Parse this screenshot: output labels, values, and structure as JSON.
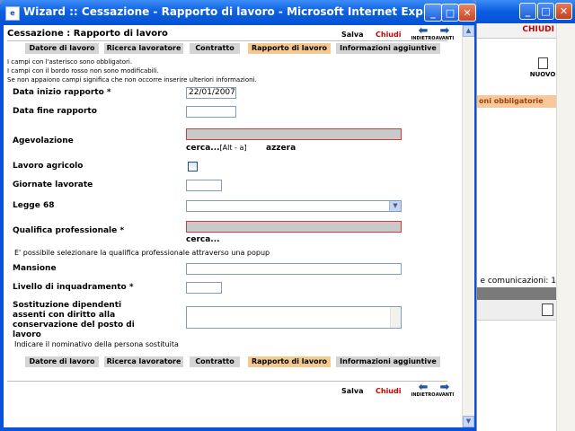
{
  "window": {
    "title": "Wizard :: Cessazione - Rapporto di lavoro - Microsoft Internet Explorer",
    "minimize_glyph": "_",
    "maximize_glyph": "□",
    "close_glyph": "✕"
  },
  "background_window": {
    "chiudi": "CHIUDI",
    "nuovo": "NUOVO",
    "obbligatorie": "oni obbligatorie",
    "comunicazioni": "e comunicazioni: 1"
  },
  "header": {
    "title": "Cessazione : Rapporto di lavoro"
  },
  "toolbar": {
    "salva": "Salva",
    "chiudi": "Chiudi",
    "indietro": "INDIETRO",
    "avanti": "AVANTI"
  },
  "tabs": [
    {
      "label": "Datore di lavoro"
    },
    {
      "label": "Ricerca lavoratore"
    },
    {
      "label": "Contratto"
    },
    {
      "label": "Rapporto di lavoro"
    },
    {
      "label": "Informazioni aggiuntive"
    }
  ],
  "notes": [
    "I campi con l'asterisco sono obbligatori.",
    "I campi con il bordo rosso non sono modificabili.",
    "Se non appaiono campi significa che non occorre inserire ulteriori informazioni."
  ],
  "form": {
    "data_inizio": {
      "label": "Data inizio rapporto *",
      "value": "22/01/2007"
    },
    "data_fine": {
      "label": "Data fine rapporto",
      "value": ""
    },
    "agevolazione": {
      "label": "Agevolazione",
      "value": "",
      "cerca": "cerca...",
      "shortcut": "[Alt - a]",
      "azzera": "azzera"
    },
    "lavoro_agricolo": {
      "label": "Lavoro agricolo"
    },
    "giornate": {
      "label": "Giornate lavorate",
      "value": ""
    },
    "legge68": {
      "label": "Legge 68",
      "value": ""
    },
    "qualifica": {
      "label": "Qualifica professionale *",
      "value": "",
      "cerca": "cerca..."
    },
    "qualifica_info": "E' possibile selezionare la qualifica professionale attraverso una popup",
    "mansione": {
      "label": "Mansione",
      "value": ""
    },
    "livello": {
      "label": "Livello di inquadramento *",
      "value": ""
    },
    "sostituzione": {
      "label_lines": [
        "Sostituzione dipendenti",
        "assenti con diritto alla",
        "conservazione del posto di",
        "lavoro"
      ]
    },
    "sostituzione_info": "Indicare il nominativo della persona sostituita"
  }
}
